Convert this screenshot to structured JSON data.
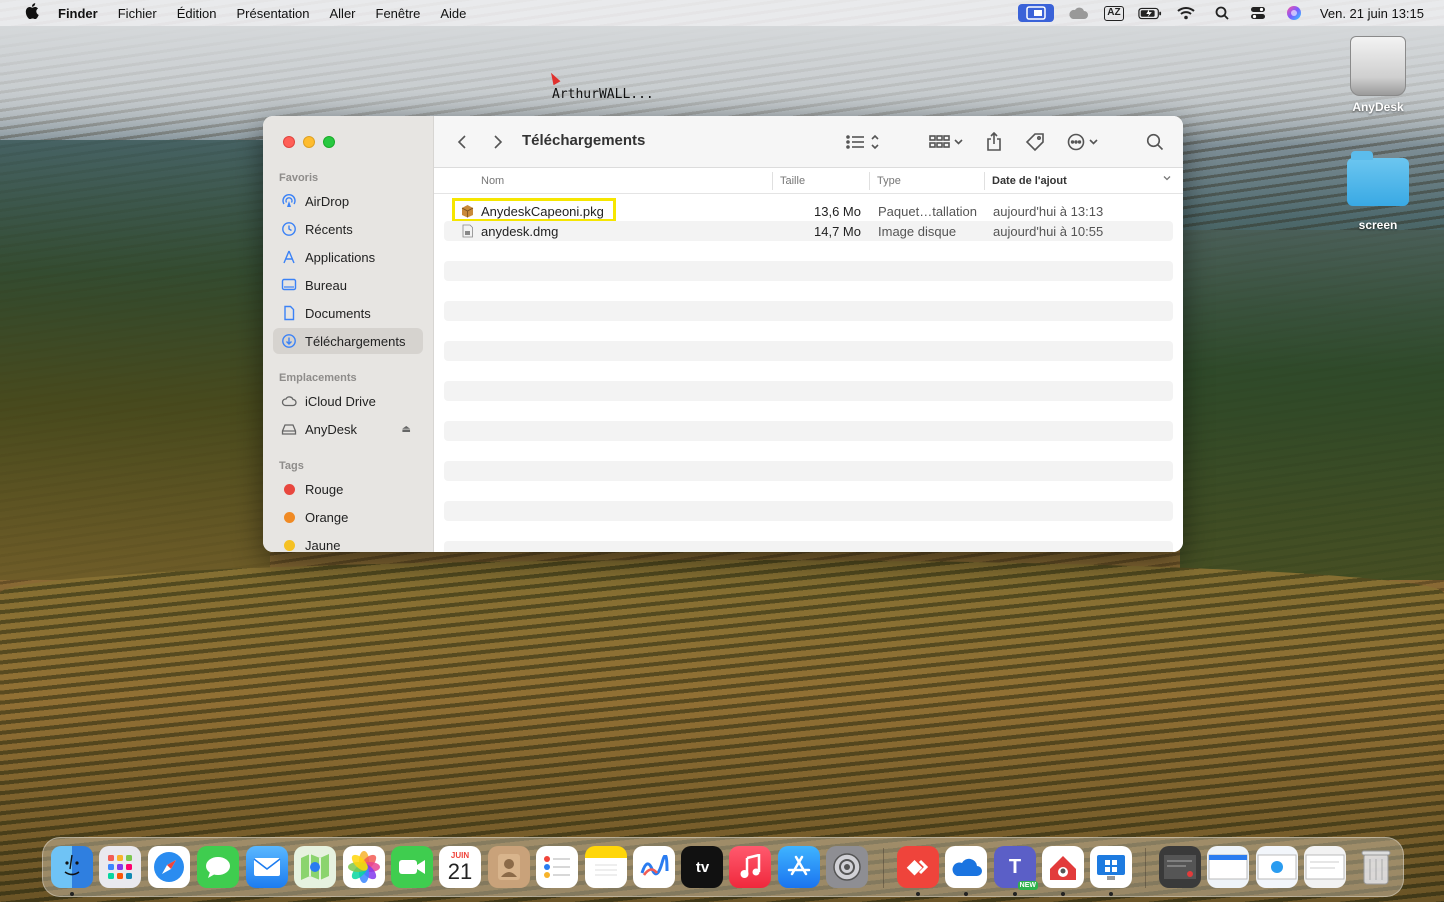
{
  "menubar": {
    "app_name": "Finder",
    "items": [
      "Fichier",
      "Édition",
      "Présentation",
      "Aller",
      "Fenêtre",
      "Aide"
    ],
    "keyboard_indicator": "AZ",
    "clock": "Ven. 21 juin  13:15"
  },
  "desktop": {
    "cursor_label": "ArthurWALL...",
    "items": [
      {
        "label": "AnyDesk",
        "icon": "drive-icon"
      },
      {
        "label": "screen",
        "icon": "folder-icon"
      }
    ]
  },
  "finder": {
    "title": "Téléchargements",
    "sidebar": {
      "favorites_header": "Favoris",
      "favorites": [
        {
          "label": "AirDrop",
          "icon": "airdrop-icon"
        },
        {
          "label": "Récents",
          "icon": "clock-icon"
        },
        {
          "label": "Applications",
          "icon": "applications-icon"
        },
        {
          "label": "Bureau",
          "icon": "desktop-icon"
        },
        {
          "label": "Documents",
          "icon": "document-icon"
        },
        {
          "label": "Téléchargements",
          "icon": "download-icon",
          "active": true
        }
      ],
      "locations_header": "Emplacements",
      "locations": [
        {
          "label": "iCloud Drive",
          "icon": "cloud-icon"
        },
        {
          "label": "AnyDesk",
          "icon": "disk-icon"
        }
      ],
      "eject_glyph": "⏏",
      "tags_header": "Tags",
      "tags": [
        {
          "label": "Rouge",
          "color": "#e8473e"
        },
        {
          "label": "Orange",
          "color": "#f08a24"
        },
        {
          "label": "Jaune",
          "color": "#f5c123"
        }
      ]
    },
    "columns": {
      "name": "Nom",
      "size": "Taille",
      "type": "Type",
      "date": "Date de l'ajout"
    },
    "files": [
      {
        "name": "AnydeskCapeoni.pkg",
        "size": "13,6 Mo",
        "type": "Paquet…tallation",
        "date": "aujourd'hui à 13:13",
        "icon": "package-icon",
        "highlighted": true
      },
      {
        "name": "anydesk.dmg",
        "size": "14,7 Mo",
        "type": "Image disque",
        "date": "aujourd'hui à 10:55",
        "icon": "disk-image-icon"
      }
    ]
  },
  "dock": {
    "calendar_month": "JUIN",
    "calendar_day": "21",
    "tv_label": "tv",
    "teams_badge": "NEW"
  },
  "colors": {
    "highlight_box": "#f6e600",
    "accent_blue": "#3b82f6"
  }
}
